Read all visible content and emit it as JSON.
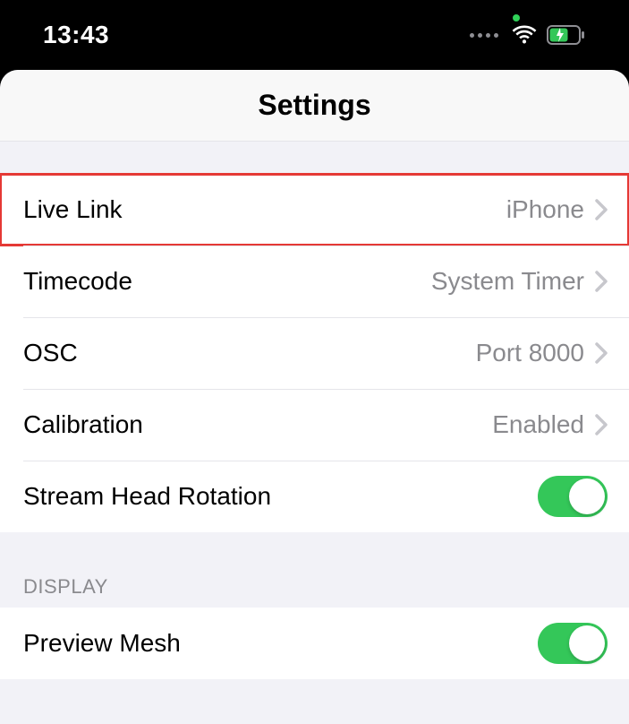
{
  "statusbar": {
    "time": "13:43"
  },
  "nav": {
    "title": "Settings"
  },
  "section1": {
    "rows": [
      {
        "label": "Live Link",
        "value": "iPhone",
        "highlighted": true
      },
      {
        "label": "Timecode",
        "value": "System Timer"
      },
      {
        "label": "OSC",
        "value": "Port 8000"
      },
      {
        "label": "Calibration",
        "value": "Enabled"
      },
      {
        "label": "Stream Head Rotation",
        "toggle": true
      }
    ]
  },
  "section2": {
    "header": "DISPLAY",
    "rows": [
      {
        "label": "Preview Mesh",
        "toggle": true
      }
    ]
  }
}
